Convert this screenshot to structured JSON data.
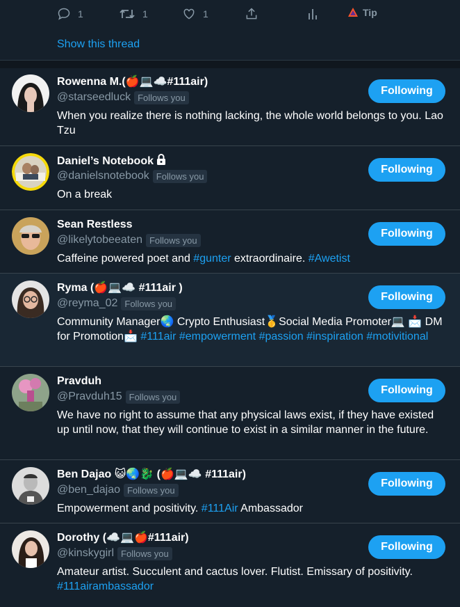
{
  "tweet_actions": {
    "reply_count": "1",
    "retweet_count": "1",
    "like_count": "1",
    "tip_label": "Tip"
  },
  "show_thread": "Show this thread",
  "follow_button_label": "Following",
  "users": [
    {
      "name": "Rowenna M.(🍎💻☁️#111air)",
      "handle": "@starseedluck",
      "follows_you": "Follows you",
      "bio_text": "When you realize there is nothing lacking, the whole world belongs to you. Lao Tzu",
      "bio_tags": ""
    },
    {
      "name": "Daniel’s Notebook",
      "handle": "@danielsnotebook",
      "follows_you": "Follows you",
      "bio_text": "On a break",
      "bio_tags": ""
    },
    {
      "name": "Sean Restless",
      "handle": "@likelytobeeaten",
      "follows_you": "Follows you",
      "bio_part1": "Caffeine powered poet and ",
      "bio_tag1": "#gunter",
      "bio_part2": " extraordinaire. ",
      "bio_tag2": "#Awetist"
    },
    {
      "name": "Ryma (🍎💻☁️ #111air )",
      "handle": "@reyma_02",
      "follows_you": "Follows you",
      "bio_text": "Community Manager🌏 Crypto Enthusiast🥇Social Media Promoter💻 📩 DM for Promotion📩 ",
      "bio_tags": "#111air #empowerment #passion #inspiration #motivitional"
    },
    {
      "name": "Pravduh",
      "handle": "@Pravduh15",
      "follows_you": "Follows you",
      "bio_text": "We have no right to assume that any physical laws exist, if they have existed up until now, that they will continue to exist in a similar manner in the future.",
      "bio_tags": ""
    },
    {
      "name": "Ben Dajao 😺🌏🐉 (🍎💻☁️ #111air)",
      "handle": "@ben_dajao",
      "follows_you": "Follows you",
      "bio_text": "Empowerment and positivity. ",
      "bio_tag": "#111Air",
      "bio_tail": " Ambassador"
    },
    {
      "name": "Dorothy (☁️💻🍎#111air)",
      "handle": "@kinskygirl",
      "follows_you": "Follows you",
      "bio_text": "Amateur artist. Succulent and cactus lover. Flutist. Emissary of positivity. ",
      "bio_tags": "#111airambassador"
    }
  ]
}
